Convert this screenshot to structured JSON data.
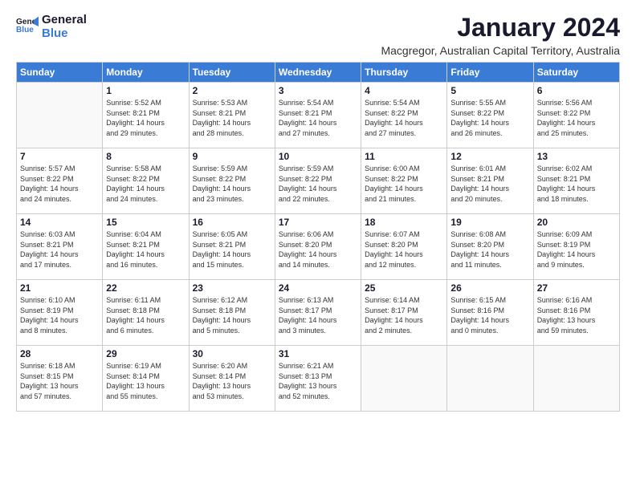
{
  "logo": {
    "line1": "General",
    "line2": "Blue"
  },
  "title": "January 2024",
  "subtitle": "Macgregor, Australian Capital Territory, Australia",
  "days_header": [
    "Sunday",
    "Monday",
    "Tuesday",
    "Wednesday",
    "Thursday",
    "Friday",
    "Saturday"
  ],
  "weeks": [
    [
      {
        "day": "",
        "info": ""
      },
      {
        "day": "1",
        "info": "Sunrise: 5:52 AM\nSunset: 8:21 PM\nDaylight: 14 hours\nand 29 minutes."
      },
      {
        "day": "2",
        "info": "Sunrise: 5:53 AM\nSunset: 8:21 PM\nDaylight: 14 hours\nand 28 minutes."
      },
      {
        "day": "3",
        "info": "Sunrise: 5:54 AM\nSunset: 8:21 PM\nDaylight: 14 hours\nand 27 minutes."
      },
      {
        "day": "4",
        "info": "Sunrise: 5:54 AM\nSunset: 8:22 PM\nDaylight: 14 hours\nand 27 minutes."
      },
      {
        "day": "5",
        "info": "Sunrise: 5:55 AM\nSunset: 8:22 PM\nDaylight: 14 hours\nand 26 minutes."
      },
      {
        "day": "6",
        "info": "Sunrise: 5:56 AM\nSunset: 8:22 PM\nDaylight: 14 hours\nand 25 minutes."
      }
    ],
    [
      {
        "day": "7",
        "info": "Sunrise: 5:57 AM\nSunset: 8:22 PM\nDaylight: 14 hours\nand 24 minutes."
      },
      {
        "day": "8",
        "info": "Sunrise: 5:58 AM\nSunset: 8:22 PM\nDaylight: 14 hours\nand 24 minutes."
      },
      {
        "day": "9",
        "info": "Sunrise: 5:59 AM\nSunset: 8:22 PM\nDaylight: 14 hours\nand 23 minutes."
      },
      {
        "day": "10",
        "info": "Sunrise: 5:59 AM\nSunset: 8:22 PM\nDaylight: 14 hours\nand 22 minutes."
      },
      {
        "day": "11",
        "info": "Sunrise: 6:00 AM\nSunset: 8:22 PM\nDaylight: 14 hours\nand 21 minutes."
      },
      {
        "day": "12",
        "info": "Sunrise: 6:01 AM\nSunset: 8:21 PM\nDaylight: 14 hours\nand 20 minutes."
      },
      {
        "day": "13",
        "info": "Sunrise: 6:02 AM\nSunset: 8:21 PM\nDaylight: 14 hours\nand 18 minutes."
      }
    ],
    [
      {
        "day": "14",
        "info": "Sunrise: 6:03 AM\nSunset: 8:21 PM\nDaylight: 14 hours\nand 17 minutes."
      },
      {
        "day": "15",
        "info": "Sunrise: 6:04 AM\nSunset: 8:21 PM\nDaylight: 14 hours\nand 16 minutes."
      },
      {
        "day": "16",
        "info": "Sunrise: 6:05 AM\nSunset: 8:21 PM\nDaylight: 14 hours\nand 15 minutes."
      },
      {
        "day": "17",
        "info": "Sunrise: 6:06 AM\nSunset: 8:20 PM\nDaylight: 14 hours\nand 14 minutes."
      },
      {
        "day": "18",
        "info": "Sunrise: 6:07 AM\nSunset: 8:20 PM\nDaylight: 14 hours\nand 12 minutes."
      },
      {
        "day": "19",
        "info": "Sunrise: 6:08 AM\nSunset: 8:20 PM\nDaylight: 14 hours\nand 11 minutes."
      },
      {
        "day": "20",
        "info": "Sunrise: 6:09 AM\nSunset: 8:19 PM\nDaylight: 14 hours\nand 9 minutes."
      }
    ],
    [
      {
        "day": "21",
        "info": "Sunrise: 6:10 AM\nSunset: 8:19 PM\nDaylight: 14 hours\nand 8 minutes."
      },
      {
        "day": "22",
        "info": "Sunrise: 6:11 AM\nSunset: 8:18 PM\nDaylight: 14 hours\nand 6 minutes."
      },
      {
        "day": "23",
        "info": "Sunrise: 6:12 AM\nSunset: 8:18 PM\nDaylight: 14 hours\nand 5 minutes."
      },
      {
        "day": "24",
        "info": "Sunrise: 6:13 AM\nSunset: 8:17 PM\nDaylight: 14 hours\nand 3 minutes."
      },
      {
        "day": "25",
        "info": "Sunrise: 6:14 AM\nSunset: 8:17 PM\nDaylight: 14 hours\nand 2 minutes."
      },
      {
        "day": "26",
        "info": "Sunrise: 6:15 AM\nSunset: 8:16 PM\nDaylight: 14 hours\nand 0 minutes."
      },
      {
        "day": "27",
        "info": "Sunrise: 6:16 AM\nSunset: 8:16 PM\nDaylight: 13 hours\nand 59 minutes."
      }
    ],
    [
      {
        "day": "28",
        "info": "Sunrise: 6:18 AM\nSunset: 8:15 PM\nDaylight: 13 hours\nand 57 minutes."
      },
      {
        "day": "29",
        "info": "Sunrise: 6:19 AM\nSunset: 8:14 PM\nDaylight: 13 hours\nand 55 minutes."
      },
      {
        "day": "30",
        "info": "Sunrise: 6:20 AM\nSunset: 8:14 PM\nDaylight: 13 hours\nand 53 minutes."
      },
      {
        "day": "31",
        "info": "Sunrise: 6:21 AM\nSunset: 8:13 PM\nDaylight: 13 hours\nand 52 minutes."
      },
      {
        "day": "",
        "info": ""
      },
      {
        "day": "",
        "info": ""
      },
      {
        "day": "",
        "info": ""
      }
    ]
  ]
}
